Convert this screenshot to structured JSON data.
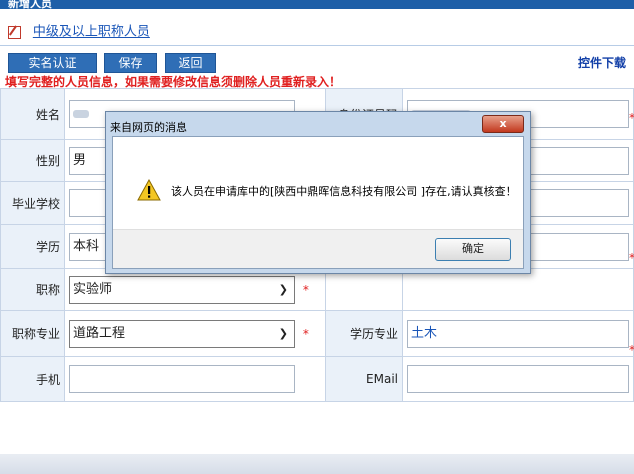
{
  "window": {
    "title": "新增人员"
  },
  "breadcrumb": {
    "label": "中级及以上职称人员"
  },
  "toolbar": {
    "realname_label": "实名认证",
    "save_label": "保存",
    "back_label": "返回",
    "download_label": "控件下载"
  },
  "notice": "填写完整的人员信息，如果需要修改信息须删除人员重新录入！",
  "form": {
    "name": {
      "label": "姓名",
      "value": ""
    },
    "idcard": {
      "label": "身份证号码",
      "value": ""
    },
    "gender": {
      "label": "性别",
      "value": "男"
    },
    "school": {
      "label": "毕业学校",
      "value": ""
    },
    "education": {
      "label": "学历",
      "value": "本科"
    },
    "title": {
      "label": "职称",
      "value": "实验师"
    },
    "title_major": {
      "label": "职称专业",
      "value": "道路工程"
    },
    "edu_major": {
      "label": "学历专业",
      "value": "土木"
    },
    "phone": {
      "label": "手机",
      "value": ""
    },
    "email": {
      "label": "EMail",
      "value": ""
    },
    "required_mark": "*"
  },
  "dialog": {
    "title": "来自网页的消息",
    "message": "该人员在申请库中的[陕西中鼎晖信息科技有限公司 ]存在,请认真核查！",
    "ok_label": "确定",
    "close_label": "x"
  },
  "colors": {
    "primary": "#2f6eb6",
    "link": "#1a56b8",
    "warning_text": "#e02020",
    "label_bg": "#eaf1f9"
  }
}
